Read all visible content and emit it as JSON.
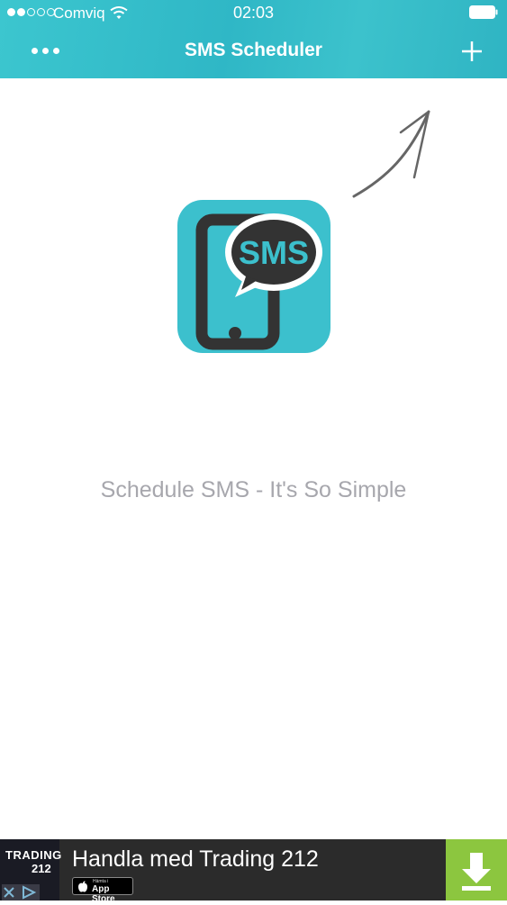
{
  "status_bar": {
    "carrier": "Comviq",
    "time": "02:03",
    "signal_filled": 2,
    "signal_total": 5
  },
  "nav_bar": {
    "title": "SMS Scheduler",
    "left_icon": "more-dots-icon",
    "right_icon": "plus-icon"
  },
  "empty_state": {
    "app_icon_label": "SMS",
    "tagline": "Schedule SMS - It's So Simple"
  },
  "ad_banner": {
    "brand_line1": "TRADING",
    "brand_line2": "212",
    "headline": "Handla med Trading 212",
    "store_badge_small": "Hämta i",
    "store_badge_big": "App Store",
    "action_icon": "download-icon"
  },
  "colors": {
    "header": "#36bdc9",
    "icon_background": "#3cc0cd",
    "icon_foreground": "#333333",
    "tagline": "#a7a7ad",
    "ad_background": "#2b2b2b",
    "download_button": "#8cc63f"
  }
}
